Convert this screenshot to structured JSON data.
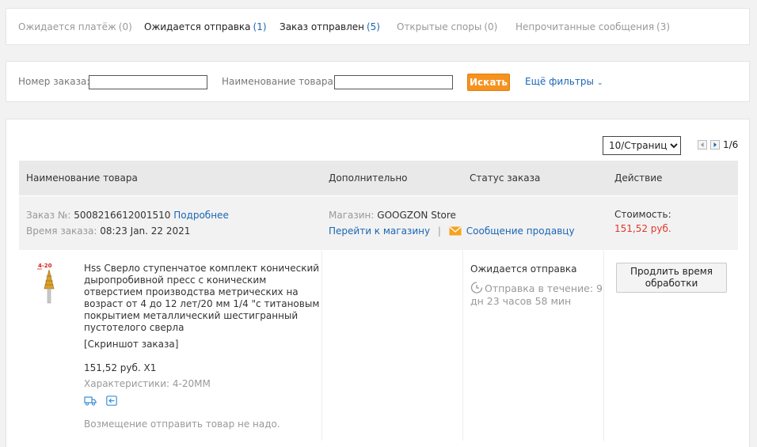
{
  "tabs": [
    {
      "label": "Ожидается платёж",
      "count": "(0)"
    },
    {
      "label": "Ожидается отправка",
      "count": "(1)"
    },
    {
      "label": "Заказ отправлен",
      "count": "(5)"
    },
    {
      "label": "Открытые споры",
      "count": "(0)"
    },
    {
      "label": "Непрочитанные сообщения",
      "count": "(3)"
    }
  ],
  "search": {
    "order_label": "Номер заказа:",
    "order_value": "",
    "product_label": "Наименование товара:",
    "product_value": "",
    "search_button": "Искать",
    "more_filters": "Ещё фильтры",
    "accent_color": "#f6921e"
  },
  "pagination": {
    "page_size": "10/Страница",
    "page_info": "1/6"
  },
  "table": {
    "headers": [
      "Наименование товара",
      "Дополнительно",
      "Статус заказа",
      "Действие"
    ]
  },
  "order": {
    "number_label": "Заказ №:",
    "number": "5008216612001510",
    "details_link": "Подробнее",
    "time_label": "Время заказа:",
    "time": "08:23 Jan. 22 2021",
    "store_label": "Магазин:",
    "store": "GOOGZON Store",
    "go_store": "Перейти к магазину",
    "separator": "|",
    "message_seller": "Сообщение продавцу",
    "cost_label": "Стоимость:",
    "cost": "151,52 руб.",
    "price_color": "#e0382a"
  },
  "item": {
    "thumb_label": "4-20",
    "title": "Hss Сверло ступенчатое комплект конический дыропробивной пресс с коническим отверстием производства метрических на возраст от 4 до 12 лет/20 мм 1/4 \"с титановым покрытием металлический шестигранный пустотелого сверла",
    "screenshot": "[Скриншот заказа]",
    "price_qty": "151,52 руб. X1",
    "characteristics": "Характеристики: 4-20MM",
    "icons": [
      "delivery-truck-icon",
      "return-icon"
    ],
    "note": "Возмещение отправить товар не надо."
  },
  "status": {
    "label": "Ожидается отправка",
    "ship_time": "Отправка в течение: 9 дн 23 часов 58 мин",
    "extend_button": "Продлить время обработки"
  }
}
